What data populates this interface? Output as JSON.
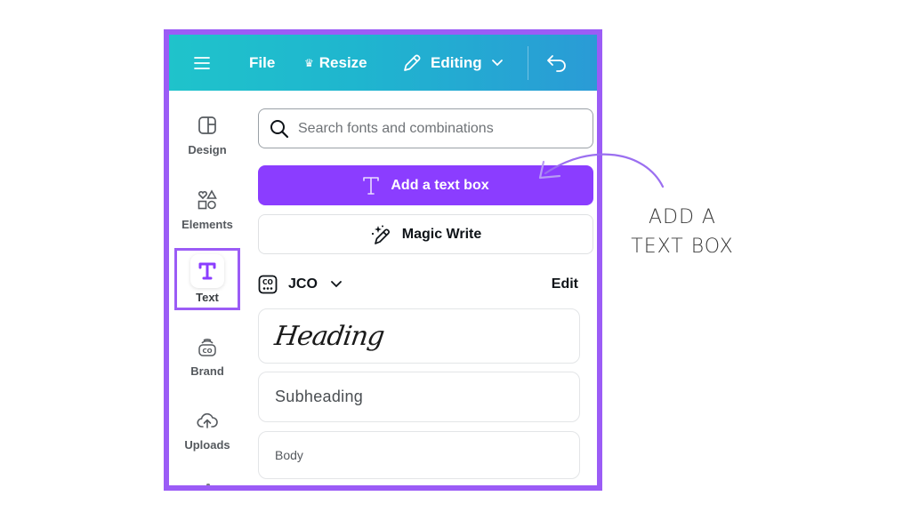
{
  "toolbar": {
    "menu_icon": "hamburger-menu-icon",
    "file_label": "File",
    "resize_icon": "crown-icon",
    "resize_label": "Resize",
    "editing_icon": "pencil-icon",
    "editing_label": "Editing",
    "editing_chevron": "chevron-down-icon",
    "undo_icon": "undo-icon"
  },
  "sidebar": {
    "items": [
      {
        "label": "Design",
        "icon": "design-layout-icon"
      },
      {
        "label": "Elements",
        "icon": "elements-shapes-icon"
      },
      {
        "label": "Text",
        "icon": "text-t-icon",
        "selected": true
      },
      {
        "label": "Brand",
        "icon": "brand-kit-icon"
      },
      {
        "label": "Uploads",
        "icon": "cloud-upload-icon"
      }
    ]
  },
  "panel": {
    "search": {
      "placeholder": "Search fonts and combinations",
      "value": ""
    },
    "add_text_box_label": "Add a text box",
    "magic_write_label": "Magic Write",
    "brand_kit": {
      "name": "JCO",
      "edit_label": "Edit"
    },
    "styles": [
      {
        "label": "Heading"
      },
      {
        "label": "Subheading"
      },
      {
        "label": "Body"
      }
    ]
  },
  "annotation": {
    "line1": "ADD A",
    "line2": "TEXT BOX"
  },
  "colors": {
    "accent_purple": "#8b3dff",
    "frame_purple": "#9b5cf6",
    "toolbar_teal": "#1fc3cb",
    "toolbar_blue": "#2a9bd6"
  }
}
